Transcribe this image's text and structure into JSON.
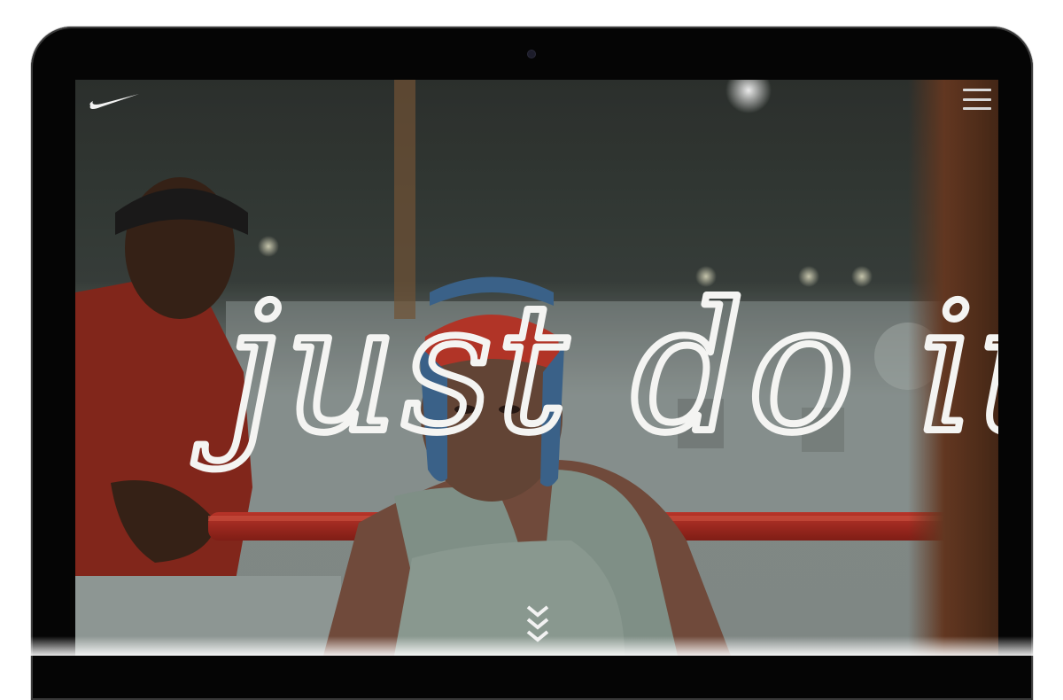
{
  "hero": {
    "headline": "just do it"
  },
  "header": {
    "logo_icon": "nike-swoosh-icon",
    "menu_icon": "hamburger-menu-icon"
  },
  "scroll": {
    "icon": "chevron-down-icon"
  },
  "colors": {
    "headline": "#f4f4f2",
    "ring_rope": "#b42b22",
    "headgear": "#c0392b",
    "device_frame": "#050505"
  }
}
